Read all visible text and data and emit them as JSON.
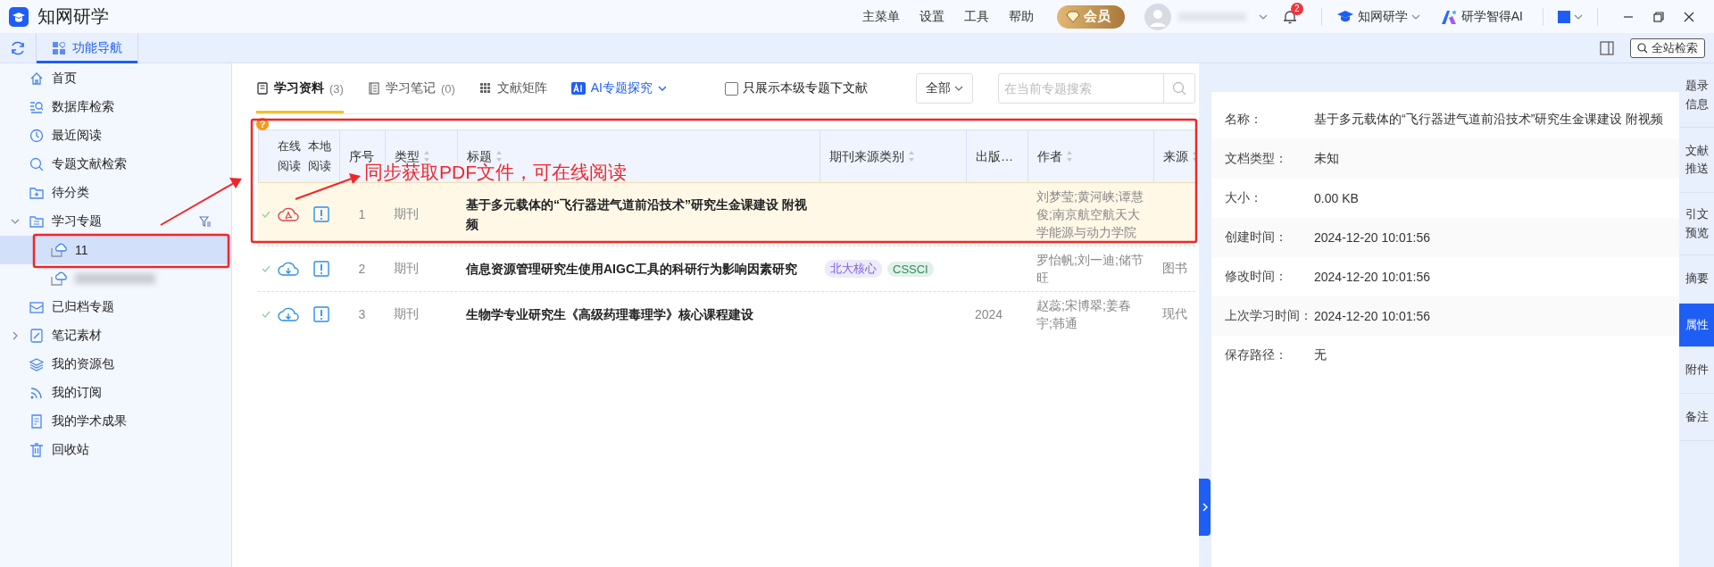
{
  "app": {
    "title": "知网研学"
  },
  "menu": [
    "主菜单",
    "设置",
    "工具",
    "帮助"
  ],
  "vip": {
    "label": "会员"
  },
  "user": {
    "name_blurred": true
  },
  "notifications": {
    "count": "2"
  },
  "products": [
    {
      "kind": "cap",
      "label": "知网研学",
      "dropdown": true
    },
    {
      "kind": "ai",
      "label": "研学智得AI",
      "dropdown": false
    }
  ],
  "nav_tabs": [
    {
      "label": "功能导航",
      "selected": true
    }
  ],
  "site_search": {
    "label": "全站检索"
  },
  "sidebar": {
    "items": [
      {
        "kind": "home",
        "label": "首页",
        "selected": false
      },
      {
        "kind": "db",
        "label": "数据库检索",
        "selected": false
      },
      {
        "kind": "clock",
        "label": "最近阅读",
        "selected": false
      },
      {
        "kind": "search",
        "label": "专题文献检索",
        "selected": false
      },
      {
        "kind": "folder-plus",
        "label": "待分类",
        "selected": false
      },
      {
        "kind": "folder",
        "label": "学习专题",
        "selected": false,
        "expanded": true,
        "filter_button": true,
        "children": [
          {
            "kind": "topic",
            "label": "11",
            "selected": true
          },
          {
            "kind": "topic",
            "label_blurred": true,
            "selected": false
          }
        ]
      },
      {
        "kind": "archive",
        "label": "已归档专题",
        "selected": false
      },
      {
        "kind": "note",
        "label": "笔记素材",
        "selected": false,
        "expanded": false
      },
      {
        "kind": "layers",
        "label": "我的资源包",
        "selected": false
      },
      {
        "kind": "rss",
        "label": "我的订阅",
        "selected": false
      },
      {
        "kind": "doc",
        "label": "我的学术成果",
        "selected": false
      },
      {
        "kind": "trash",
        "label": "回收站",
        "selected": false
      }
    ]
  },
  "content": {
    "tabs": [
      {
        "kind": "book",
        "label": "学习资料",
        "count": "(3)",
        "selected": true
      },
      {
        "kind": "notebook",
        "label": "学习笔记",
        "count": "(0)",
        "selected": false
      },
      {
        "kind": "grid",
        "label": "文献矩阵",
        "selected": false
      },
      {
        "kind": "ai",
        "label": "AI专题探究",
        "selected": false
      }
    ],
    "only_this_level": {
      "label": "只展示本级专题下文献",
      "checked": false
    },
    "scope": {
      "value": "全部"
    },
    "search": {
      "placeholder": "在当前专题搜索"
    },
    "help_badge": "?",
    "table": {
      "columns": [
        {
          "label": "在线阅读",
          "sortable": false
        },
        {
          "label": "本地阅读",
          "sortable": false
        },
        {
          "label": "序号",
          "sortable": false
        },
        {
          "label": "类型",
          "sortable": true
        },
        {
          "label": "标题",
          "sortable": true
        },
        {
          "label": "期刊来源类别",
          "sortable": true
        },
        {
          "label": "出版…",
          "sortable": false
        },
        {
          "label": "作者",
          "sortable": true
        },
        {
          "label": "来源",
          "sortable": true
        }
      ],
      "rows": [
        {
          "done": true,
          "selected": true,
          "kind": "pdf",
          "index": "1",
          "type": "期刊",
          "title": "基于多元载体的“飞行器进气道前沿技术”研究生金课建设 附视频",
          "tags": [],
          "authors": "刘梦莹;黄河峡;谭慧俊;南京航空航天大学能源与动力学院"
        },
        {
          "done": true,
          "selected": false,
          "kind": "cloud",
          "index": "2",
          "type": "期刊",
          "title": "信息资源管理研究生使用AIGC工具的科研行为影响因素研究",
          "tags": [
            {
              "label": "北大核心",
              "color": "#7b61d9"
            },
            {
              "label": "CSSCI",
              "color": "#2e8b63"
            }
          ],
          "authors": "罗怡帆;刘一迪;储节旺",
          "source": "图书"
        },
        {
          "done": true,
          "selected": false,
          "kind": "cloud",
          "index": "3",
          "type": "期刊",
          "title": "生物学专业研究生《高级药理毒理学》核心课程建设",
          "tags": [],
          "year": "2024",
          "authors": "赵蕊;宋博翠;姜春宇;韩通",
          "source": "现代"
        }
      ]
    },
    "annotation": {
      "text": "同步获取PDF文件，可在线阅读"
    }
  },
  "details": {
    "rows": [
      {
        "label": "名称：",
        "value": "基于多元载体的“飞行器进气道前沿技术”研究生金课建设 附视频"
      },
      {
        "label": "文档类型：",
        "value": "未知"
      },
      {
        "label": "大小：",
        "value": "0.00 KB"
      },
      {
        "label": "创建时间：",
        "value": "2024-12-20 10:01:56"
      },
      {
        "label": "修改时间：",
        "value": "2024-12-20 10:01:56"
      },
      {
        "label": "上次学习时间：",
        "value": "2024-12-20 10:01:56"
      },
      {
        "label": "保存路径：",
        "value": "无"
      }
    ]
  },
  "side_tabs": [
    {
      "label": "题录信息",
      "selected": false
    },
    {
      "label": "文献推送",
      "selected": false
    },
    {
      "label": "引文预览",
      "selected": false
    },
    {
      "label": "摘要",
      "selected": false
    },
    {
      "label": "属性",
      "selected": true
    },
    {
      "label": "附件",
      "selected": false
    },
    {
      "label": "备注",
      "selected": false
    }
  ]
}
